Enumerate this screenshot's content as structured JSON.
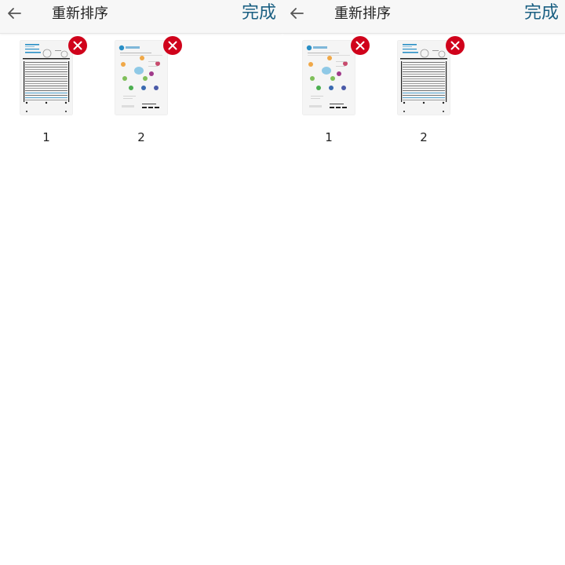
{
  "screens": [
    {
      "title": "重新排序",
      "done_label": "完成",
      "pages": [
        {
          "number": "1",
          "thumb": "alignment-page-thumbnail"
        },
        {
          "number": "2",
          "thumb": "welcome-page-thumbnail"
        }
      ]
    },
    {
      "title": "重新排序",
      "done_label": "完成",
      "pages": [
        {
          "number": "1",
          "thumb": "welcome-page-thumbnail"
        },
        {
          "number": "2",
          "thumb": "alignment-page-thumbnail"
        }
      ]
    }
  ],
  "icons": {
    "back": "arrow-left-icon",
    "delete": "close-icon"
  },
  "colors": {
    "accent": "#1a5f82",
    "delete_badge": "#d0021b",
    "appbar": "#f7f7f7"
  }
}
